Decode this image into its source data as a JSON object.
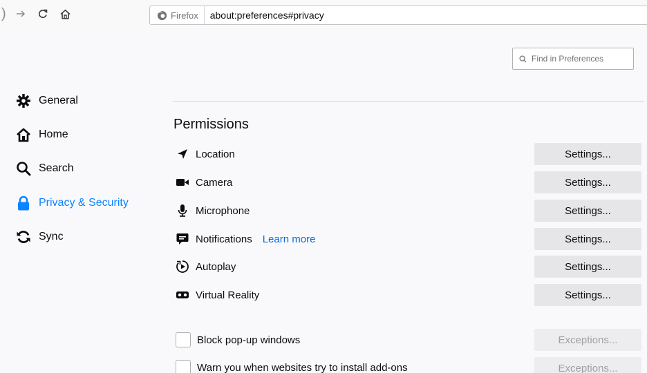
{
  "toolbar": {
    "identity_label": "Firefox",
    "url": "about:preferences#privacy"
  },
  "search": {
    "placeholder": "Find in Preferences"
  },
  "sidebar": {
    "items": [
      {
        "label": "General",
        "icon": "gear-icon"
      },
      {
        "label": "Home",
        "icon": "home-icon"
      },
      {
        "label": "Search",
        "icon": "search-icon"
      },
      {
        "label": "Privacy & Security",
        "icon": "lock-icon",
        "selected": true
      },
      {
        "label": "Sync",
        "icon": "sync-icon"
      }
    ]
  },
  "main": {
    "section_title": "Permissions",
    "permissions": [
      {
        "label": "Location",
        "icon": "location-arrow-icon",
        "button": "Settings..."
      },
      {
        "label": "Camera",
        "icon": "camera-icon",
        "button": "Settings..."
      },
      {
        "label": "Microphone",
        "icon": "microphone-icon",
        "button": "Settings..."
      },
      {
        "label": "Notifications",
        "icon": "notification-icon",
        "button": "Settings...",
        "link": "Learn more"
      },
      {
        "label": "Autoplay",
        "icon": "autoplay-icon",
        "button": "Settings..."
      },
      {
        "label": "Virtual Reality",
        "icon": "vr-headset-icon",
        "button": "Settings..."
      }
    ],
    "checkboxes": [
      {
        "label": "Block pop-up windows",
        "checked": false,
        "button": "Exceptions..."
      },
      {
        "label": "Warn you when websites try to install add-ons",
        "checked": false,
        "button": "Exceptions..."
      }
    ]
  },
  "colors": {
    "accent": "#0a84ff",
    "link": "#0a6bd8",
    "button_bg": "#e6e6e8",
    "page_bg": "#f9f9fb"
  }
}
